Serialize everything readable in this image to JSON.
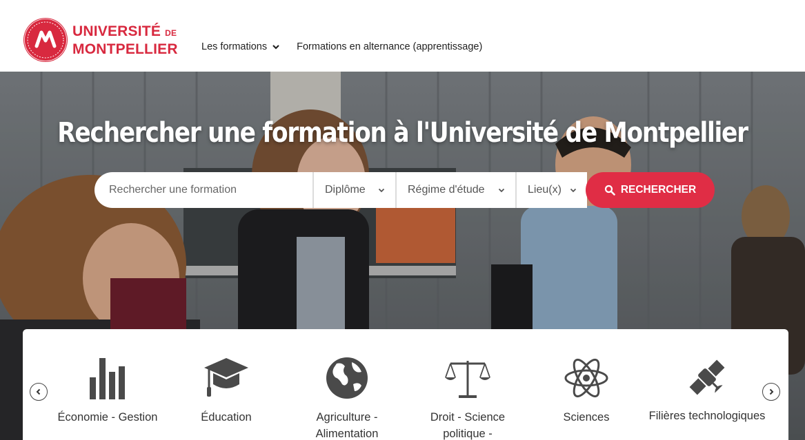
{
  "header": {
    "logo": {
      "line1": "UNIVERSITÉ",
      "line1_suffix": "DE",
      "line2": "MONTPELLIER",
      "brand_color": "#d8293f"
    },
    "nav": [
      {
        "label": "Les formations",
        "icon": "chevron-down-icon"
      },
      {
        "label": "Formations en alternance (apprentissage)"
      }
    ]
  },
  "hero": {
    "title": "Rechercher une formation à l'Université de Montpellier",
    "search": {
      "placeholder": "Rechercher une formation",
      "value": "",
      "filters": [
        {
          "label": "Diplôme",
          "icon": "chevron-down-icon"
        },
        {
          "label": "Régime d'étude",
          "icon": "chevron-down-icon"
        },
        {
          "label": "Lieu(x)",
          "icon": "chevron-down-icon"
        }
      ],
      "button_label": "RECHERCHER",
      "button_icon": "search-icon",
      "accent_color": "#e02d45"
    }
  },
  "categories": {
    "prev_icon": "chevron-left-icon",
    "next_icon": "chevron-right-icon",
    "items": [
      {
        "label": "Économie - Gestion",
        "icon": "bar-chart-icon"
      },
      {
        "label": "Éducation",
        "icon": "graduation-cap-icon"
      },
      {
        "label": "Agriculture - Alimentation",
        "icon": "globe-icon"
      },
      {
        "label": "Droit - Science politique -",
        "icon": "scales-icon"
      },
      {
        "label": "Sciences",
        "icon": "atom-icon"
      },
      {
        "label": "Filières technologiques",
        "icon": "satellite-icon"
      }
    ]
  }
}
